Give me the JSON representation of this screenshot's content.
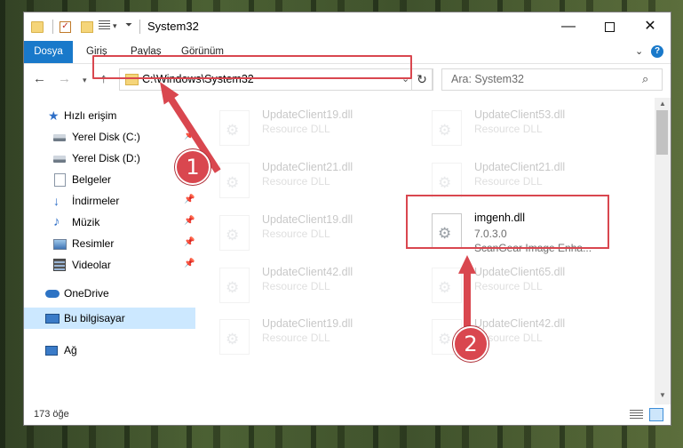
{
  "window": {
    "title": "System32"
  },
  "ribbon": {
    "tabs": [
      "Dosya",
      "Giriş",
      "Paylaş",
      "Görünüm"
    ]
  },
  "address": {
    "path": "C:\\Windows\\System32",
    "search_placeholder": "Ara: System32"
  },
  "sidebar": {
    "items": [
      {
        "label": "Hızlı erişim",
        "icon": "star-icon",
        "pinned": false
      },
      {
        "label": "Yerel Disk (C:)",
        "icon": "disk-icon",
        "pinned": true
      },
      {
        "label": "Yerel Disk (D:)",
        "icon": "disk-icon",
        "pinned": false
      },
      {
        "label": "Belgeler",
        "icon": "document-icon",
        "pinned": false
      },
      {
        "label": "İndirmeler",
        "icon": "download-icon",
        "pinned": true
      },
      {
        "label": "Müzik",
        "icon": "music-icon",
        "pinned": true
      },
      {
        "label": "Resimler",
        "icon": "pictures-icon",
        "pinned": true
      },
      {
        "label": "Videolar",
        "icon": "videos-icon",
        "pinned": true
      },
      {
        "label": "OneDrive",
        "icon": "cloud-icon",
        "pinned": false
      },
      {
        "label": "Bu bilgisayar",
        "icon": "computer-icon",
        "pinned": false,
        "selected": true
      },
      {
        "label": "Ağ",
        "icon": "network-icon",
        "pinned": false
      }
    ]
  },
  "files": {
    "left_column": [
      {
        "name": "UpdateClient19.dll",
        "desc": "Resource DLL"
      },
      {
        "name": "UpdateClient21.dll",
        "desc": "Resource DLL"
      },
      {
        "name": "UpdateClient19.dll",
        "desc": "Resource DLL"
      },
      {
        "name": "UpdateClient42.dll",
        "desc": "Resource DLL"
      },
      {
        "name": "UpdateClient19.dll",
        "desc": "Resource DLL"
      }
    ],
    "right_column": [
      {
        "name": "UpdateClient53.dll",
        "desc": "Resource DLL"
      },
      {
        "name": "UpdateClient21.dll",
        "desc": "Resource DLL"
      },
      {
        "name": "UpdateClient65.dll",
        "desc": "Resource DLL"
      },
      {
        "name": "UpdateClient42.dll",
        "desc": "Resource DLL"
      }
    ],
    "highlighted": {
      "name": "imgenh.dll",
      "version": "7.0.3.0",
      "desc": "ScanGear Image Enha..."
    }
  },
  "status": {
    "item_count": "173 öğe"
  },
  "callouts": {
    "one": "1",
    "two": "2"
  },
  "colors": {
    "accent": "#1979ca",
    "callout": "#d9474f",
    "selection": "#cce8ff"
  }
}
